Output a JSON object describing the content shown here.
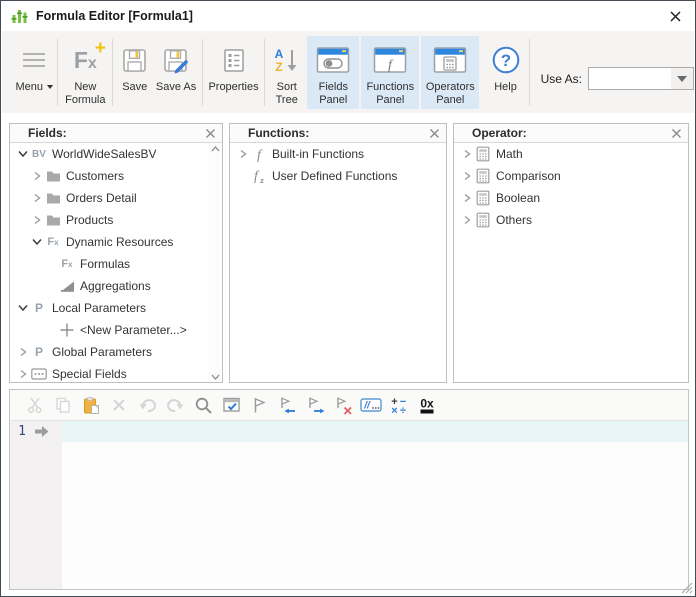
{
  "colors": {
    "accent_blue": "#2e7cd6",
    "panel_toggle_highlight": "#dbe9f7",
    "logo_green": "#76c043",
    "accent_yellow": "#f2c239",
    "clear_red": "#e25e5e",
    "current_line_highlight": "#e9f6f8"
  },
  "title_bar": {
    "title": "Formula Editor [Formula1]"
  },
  "toolbar": {
    "menu_label": "Menu",
    "new_formula_label": "New Formula",
    "save_label": "Save",
    "save_as_label": "Save As",
    "properties_label": "Properties",
    "sort_tree_label": "Sort Tree",
    "fields_panel_label": "Fields Panel",
    "functions_panel_label": "Functions Panel",
    "operators_panel_label": "Operators Panel",
    "help_label": "Help",
    "use_as_label": "Use As:",
    "use_as_value": ""
  },
  "fields_panel": {
    "title": "Fields:",
    "items": [
      {
        "label": "WorldWideSalesBV",
        "icon": "bv-icon",
        "expander": "expanded",
        "indent": 0
      },
      {
        "label": "Customers",
        "icon": "folder-icon",
        "expander": "collapsed",
        "indent": 1
      },
      {
        "label": "Orders Detail",
        "icon": "folder-icon",
        "expander": "collapsed",
        "indent": 1
      },
      {
        "label": "Products",
        "icon": "folder-icon",
        "expander": "collapsed",
        "indent": 1
      },
      {
        "label": "Dynamic Resources",
        "icon": "fx-icon",
        "expander": "expanded",
        "indent": 1
      },
      {
        "label": "Formulas",
        "icon": "fx-icon",
        "expander": "none",
        "indent": 2
      },
      {
        "label": "Aggregations",
        "icon": "aggregation-icon",
        "expander": "none",
        "indent": 2
      },
      {
        "label": "Local Parameters",
        "icon": "parameter-icon",
        "expander": "expanded",
        "indent": 0
      },
      {
        "label": "<New Parameter...>",
        "icon": "plus-icon",
        "expander": "none",
        "indent": 2
      },
      {
        "label": "Global Parameters",
        "icon": "parameter-icon",
        "expander": "collapsed",
        "indent": 0
      },
      {
        "label": "Special Fields",
        "icon": "special-fields-icon",
        "expander": "collapsed",
        "indent": 0
      }
    ]
  },
  "functions_panel": {
    "title": "Functions:",
    "items": [
      {
        "label": "Built-in Functions",
        "icon": "function-icon",
        "expander": "collapsed",
        "indent": 0
      },
      {
        "label": "User Defined Functions",
        "icon": "user-function-icon",
        "expander": "none",
        "indent": 0
      }
    ]
  },
  "operators_panel": {
    "title": "Operator:",
    "items": [
      {
        "label": "Math",
        "icon": "calculator-icon",
        "expander": "collapsed",
        "indent": 0
      },
      {
        "label": "Comparison",
        "icon": "calculator-icon",
        "expander": "collapsed",
        "indent": 0
      },
      {
        "label": "Boolean",
        "icon": "calculator-icon",
        "expander": "collapsed",
        "indent": 0
      },
      {
        "label": "Others",
        "icon": "calculator-icon",
        "expander": "collapsed",
        "indent": 0
      }
    ]
  },
  "formula_bar": {
    "buttons": [
      {
        "name": "cut",
        "enabled": false
      },
      {
        "name": "copy",
        "enabled": false
      },
      {
        "name": "paste",
        "enabled": true
      },
      {
        "name": "delete",
        "enabled": false
      },
      {
        "name": "undo",
        "enabled": false
      },
      {
        "name": "redo",
        "enabled": false
      },
      {
        "name": "search",
        "enabled": true
      },
      {
        "name": "validate",
        "enabled": true
      },
      {
        "name": "bookmark",
        "enabled": true
      },
      {
        "name": "previous-bookmark",
        "enabled": true
      },
      {
        "name": "next-bookmark",
        "enabled": true
      },
      {
        "name": "clear-bookmarks",
        "enabled": true
      },
      {
        "name": "comment",
        "enabled": true
      },
      {
        "name": "operators",
        "enabled": true
      },
      {
        "name": "hex",
        "enabled": true
      }
    ]
  },
  "editor": {
    "lines": [
      {
        "number": "1",
        "content": ""
      }
    ]
  }
}
